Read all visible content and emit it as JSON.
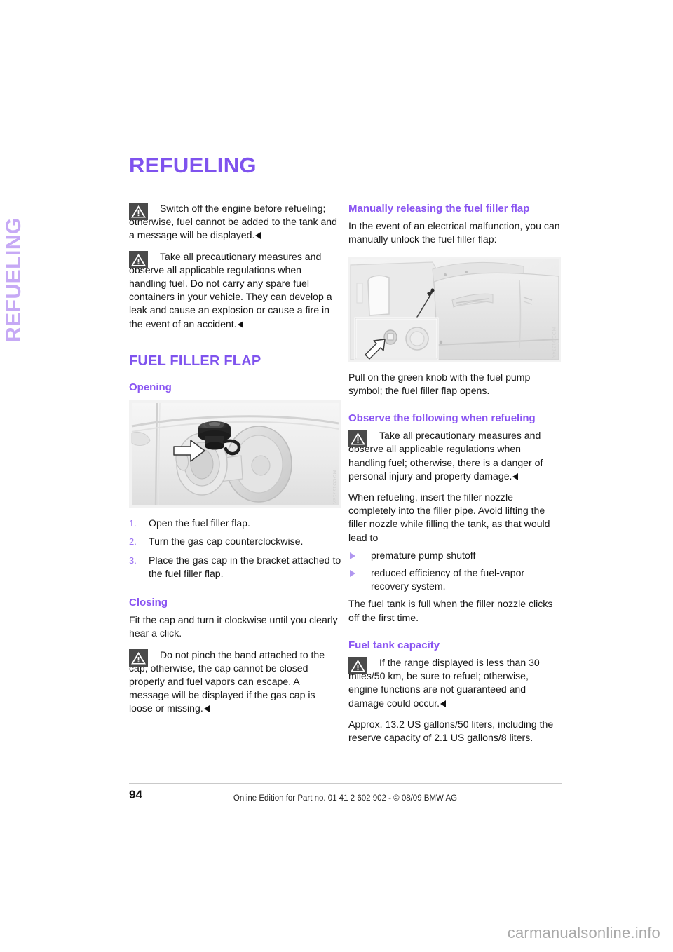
{
  "document": {
    "running_head": "REFUELING",
    "title": "REFUELING",
    "accent_color": "#7f53ee",
    "running_head_color": "#c6a9f5",
    "bullet_color": "#b096f0"
  },
  "left_column": {
    "warning_1": {
      "icon": "warning-triangle-icon",
      "text": "Switch off the engine before refueling; otherwise, fuel cannot be added to the tank and a message will be displayed."
    },
    "warning_2": {
      "icon": "warning-triangle-icon",
      "text": "Take all precautionary measures and observe all applicable regulations when handling fuel. Do not carry any spare fuel containers in your vehicle. They can develop a leak and cause an explosion or cause a fire in the event of an accident."
    },
    "section_heading": "FUEL FILLER FLAP",
    "opening": {
      "heading": "Opening",
      "figure_code": "MOCO1371SA",
      "figure_alt": "fuel filler flap with gas cap removed and arrow pointing to cap bracket",
      "steps": [
        {
          "number": "1.",
          "text": "Open the fuel filler flap."
        },
        {
          "number": "2.",
          "text": "Turn the gas cap counterclockwise."
        },
        {
          "number": "3.",
          "text": "Place the gas cap in the bracket attached to the fuel filler flap."
        }
      ]
    },
    "closing": {
      "heading": "Closing",
      "paragraph": "Fit the cap and turn it clockwise until you clearly hear a click.",
      "warning": {
        "icon": "warning-triangle-icon",
        "text": "Do not pinch the band attached to the cap; otherwise, the cap cannot be closed properly and fuel vapors can escape. A message will be displayed if the gas cap is loose or missing."
      }
    }
  },
  "right_column": {
    "manual_release": {
      "heading": "Manually releasing the fuel filler flap",
      "intro": "In the event of an electrical malfunction, you can manually unlock the fuel filler flap:",
      "figure_code": "MOCO1374A",
      "figure_alt": "trunk side panel interior showing green release knob location with detail inset",
      "caption": "Pull on the green knob with the fuel pump symbol; the fuel filler flap opens."
    },
    "observe": {
      "heading": "Observe the following when refueling",
      "warning": {
        "icon": "warning-triangle-icon",
        "text": "Take all precautionary measures and observe all applicable regulations when handling fuel; otherwise, there is a danger of personal injury and property damage."
      },
      "paragraph": "When refueling, insert the filler nozzle completely into the filler pipe. Avoid lifting the filler nozzle while filling the tank, as that would lead to",
      "bullets": [
        "premature pump shutoff",
        "reduced efficiency of the fuel-vapor recovery system."
      ],
      "closing_paragraph": "The fuel tank is full when the filler nozzle clicks off the first time."
    },
    "fuel_tank_capacity": {
      "heading": "Fuel tank capacity",
      "warning": {
        "icon": "warning-triangle-icon",
        "text": "If the range displayed is less than 30 miles/50 km, be sure to refuel; otherwise, engine functions are not guaranteed and damage could occur."
      },
      "paragraph": "Approx. 13.2 US gallons/50 liters, including the reserve capacity of 2.1 US gallons/8 liters."
    }
  },
  "footer": {
    "page_number": "94",
    "note": "Online Edition for Part no. 01 41 2 602 902 - © 08/09 BMW AG"
  },
  "watermark": "carmanualsonline.info"
}
